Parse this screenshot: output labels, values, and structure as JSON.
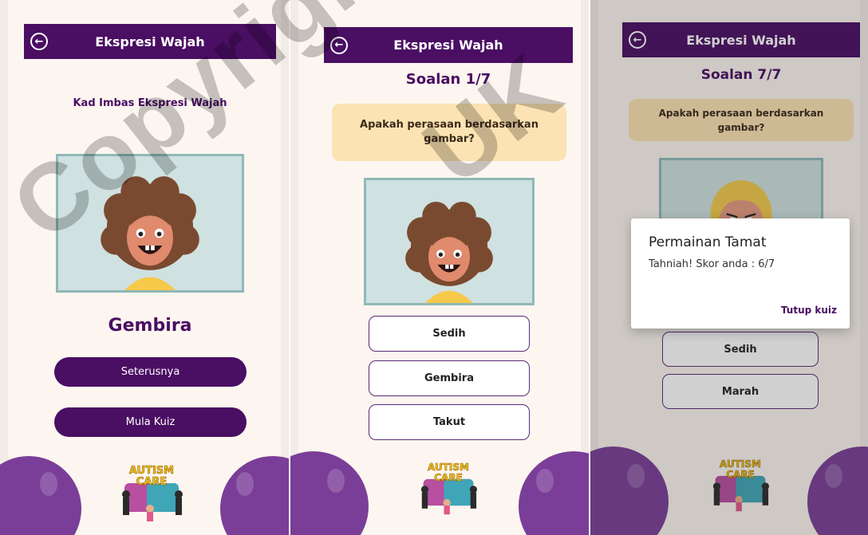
{
  "screen1": {
    "title": "Ekspresi Wajah",
    "subtitle": "Kad Imbas Ekspresi Wajah",
    "emotion": "Gembira",
    "next_label": "Seterusnya",
    "quiz_label": "Mula Kuiz",
    "logo_line1": "AUTISM",
    "logo_line2": "CARE"
  },
  "screen2": {
    "title": "Ekspresi Wajah",
    "counter": "Soalan 1/7",
    "question": "Apakah perasaan berdasarkan gambar?",
    "options": [
      "Sedih",
      "Gembira",
      "Takut"
    ],
    "logo_line1": "AUTISM",
    "logo_line2": "CARE"
  },
  "screen3": {
    "title": "Ekspresi Wajah",
    "counter": "Soalan 7/7",
    "question": "Apakah perasaan berdasarkan gambar?",
    "options": [
      "Sedih",
      "Marah"
    ],
    "dialog": {
      "title": "Permainan Tamat",
      "message": "Tahniah! Skor anda : 6/7",
      "close_label": "Tutup kuiz"
    },
    "logo_line1": "AUTISM",
    "logo_line2": "CARE"
  },
  "watermark": {
    "word1": "Copyright",
    "word2": "UK"
  },
  "colors": {
    "appbar": "#4a0e63",
    "background": "#fdf6f0",
    "question_box": "#fbe3b3",
    "blob": "#7a3e98"
  }
}
